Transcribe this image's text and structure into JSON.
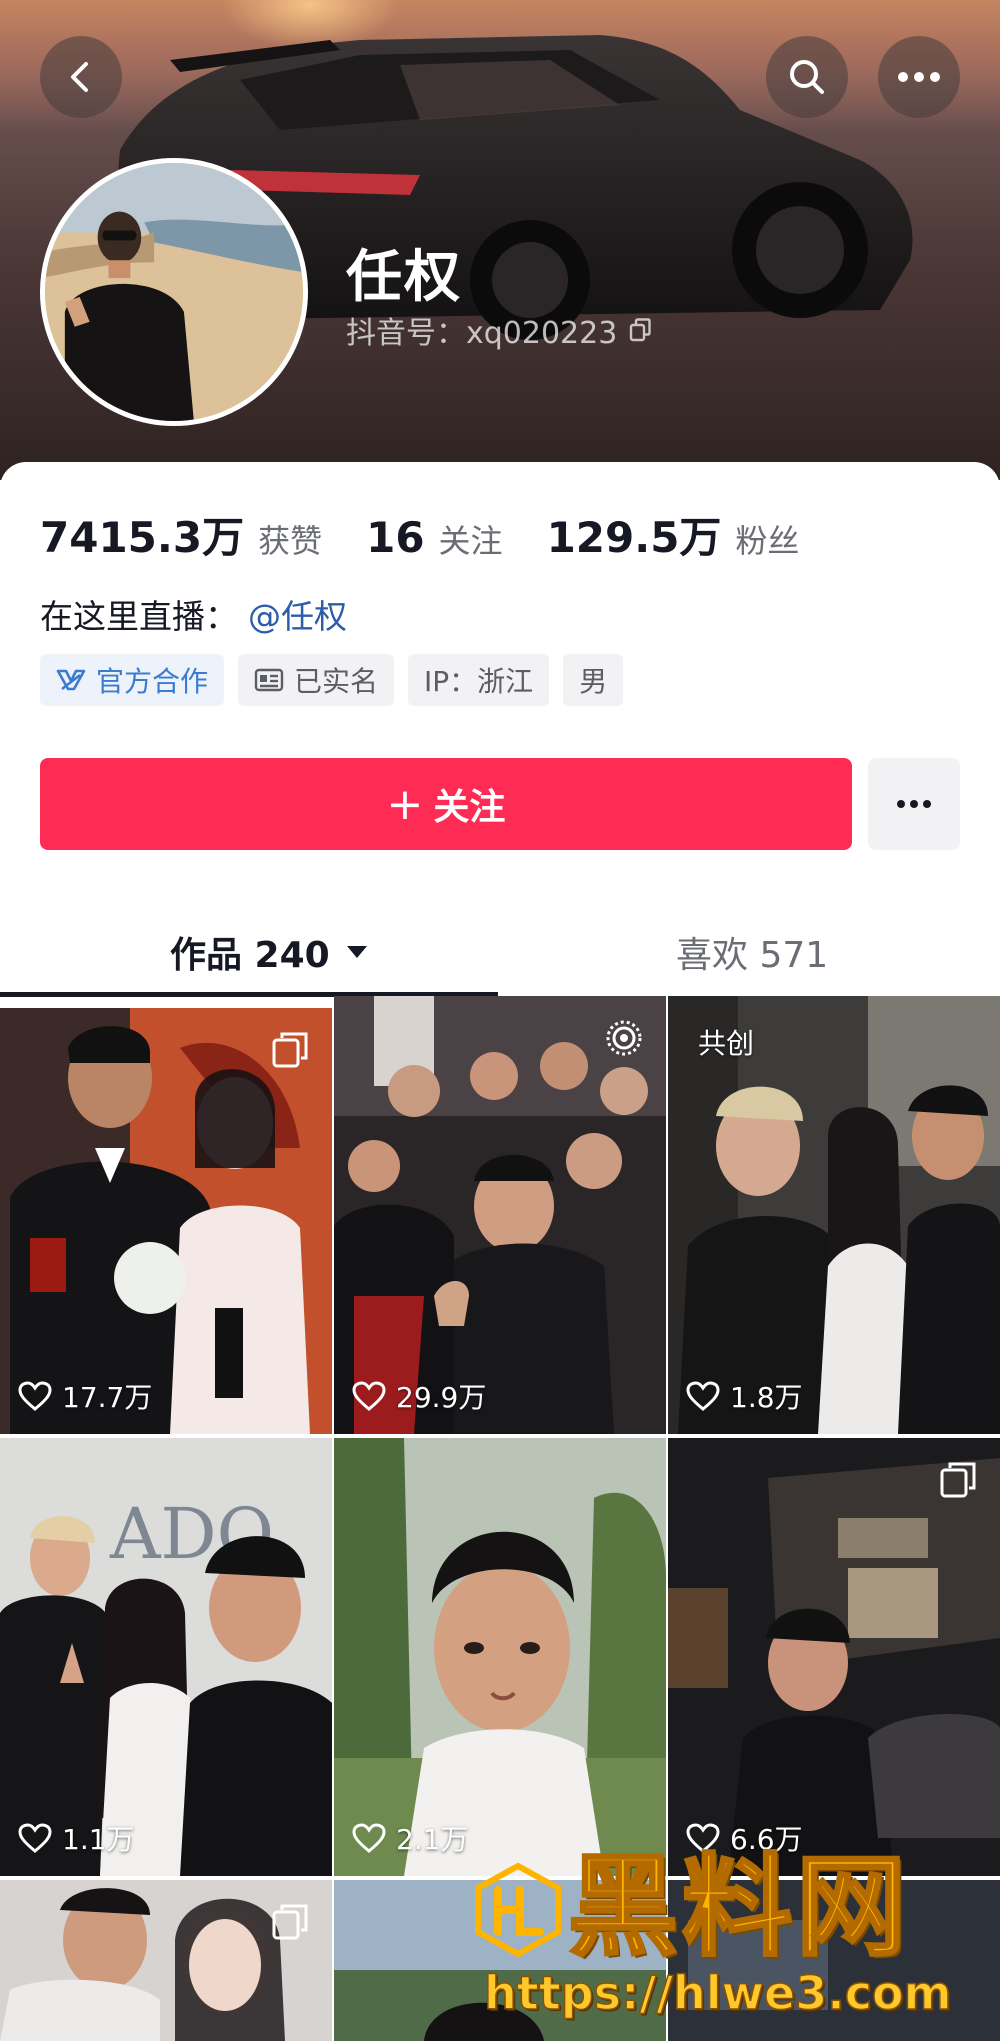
{
  "profile": {
    "nickname": "任权",
    "douyin_id": "抖音号：xq020223"
  },
  "stats": [
    {
      "value": "7415.3万",
      "label": "获赞"
    },
    {
      "value": "16",
      "label": "关注"
    },
    {
      "value": "129.5万",
      "label": "粉丝"
    }
  ],
  "live": {
    "prefix": "在这里直播：",
    "link": "@任权"
  },
  "tags": {
    "official": "官方合作",
    "verified": "已实名",
    "ip": "IP：浙江",
    "gender": "男"
  },
  "actions": {
    "follow_plus": "+",
    "follow_label": "关注"
  },
  "tabs": {
    "works": "作品 240",
    "likes": "喜欢 571"
  },
  "videos": [
    {
      "likes": "17.7万",
      "multi_image": true
    },
    {
      "likes": "29.9万",
      "live_photo": true
    },
    {
      "likes": "1.8万",
      "badge": "共创"
    },
    {
      "likes": "1.1万"
    },
    {
      "likes": "2.1万"
    },
    {
      "likes": "6.6万",
      "multi_image": true
    }
  ],
  "watermark": {
    "title": "黑料网",
    "url": "https://hlwe3.com"
  },
  "colors": {
    "accent": "#fe2c55",
    "link": "#2d5ca8",
    "watermark": "#ffb400"
  },
  "icons": [
    "back-arrow-icon",
    "search-icon",
    "more-icon",
    "copy-icon",
    "official-cooperation-icon",
    "id-card-icon",
    "caret-down-icon",
    "heart-icon",
    "multi-image-icon",
    "live-photo-icon"
  ]
}
